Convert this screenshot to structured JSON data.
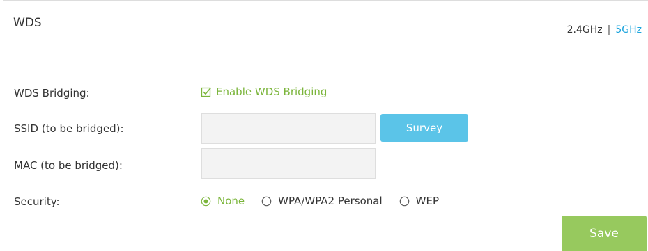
{
  "header": {
    "title": "WDS",
    "band_24": "2.4GHz",
    "separator": "|",
    "band_5": "5GHz"
  },
  "form": {
    "wds_bridging": {
      "label": "WDS Bridging:",
      "checkbox_label": "Enable WDS Bridging",
      "checked": true
    },
    "ssid": {
      "label": "SSID (to be bridged):",
      "value": "",
      "survey_label": "Survey"
    },
    "mac": {
      "label": "MAC (to be bridged):",
      "value": ""
    },
    "security": {
      "label": "Security:",
      "options": [
        "None",
        "WPA/WPA2 Personal",
        "WEP"
      ],
      "selected": "None"
    }
  },
  "actions": {
    "save_label": "Save"
  },
  "colors": {
    "accent_green": "#7bb53b",
    "link_blue": "#1ba4dd",
    "survey_blue": "#5bc4e8",
    "save_green": "#97c95e"
  },
  "icons": {
    "checkbox": "checkbox-checked-icon",
    "radio_selected": "radio-selected-icon",
    "radio_unselected": "radio-unselected-icon"
  }
}
